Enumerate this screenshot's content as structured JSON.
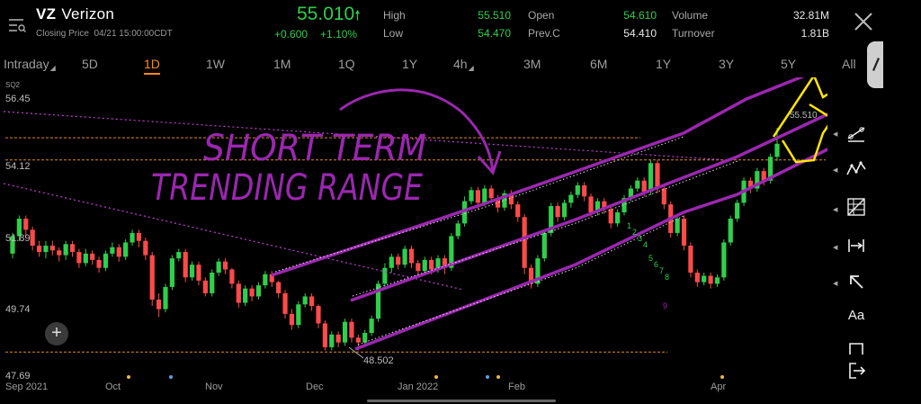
{
  "header": {
    "symbol": "VZ",
    "name": "Verizon",
    "closing_label": "Closing Price",
    "closing_time": "04/21 15:00:00CDT",
    "price": "55.010",
    "change": "+0.600",
    "change_pct": "+1.10%",
    "stats": [
      {
        "label": "High",
        "value": "55.510",
        "color": "green"
      },
      {
        "label": "Low",
        "value": "54.470",
        "color": "green"
      },
      {
        "label": "Open",
        "value": "54.610",
        "color": "green"
      },
      {
        "label": "Prev.C",
        "value": "54.410",
        "color": "white"
      },
      {
        "label": "Volume",
        "value": "32.81M",
        "color": "white"
      },
      {
        "label": "Turnover",
        "value": "1.81B",
        "color": "white"
      }
    ]
  },
  "tabs": [
    {
      "label": "Intraday",
      "dropdown": true
    },
    {
      "label": "5D"
    },
    {
      "label": "1D",
      "active": true
    },
    {
      "label": "1W"
    },
    {
      "label": "1M"
    },
    {
      "label": "1Q"
    },
    {
      "label": "1Y"
    },
    {
      "label": "4h",
      "dropdown": true
    },
    {
      "label": "3M"
    },
    {
      "label": "6M"
    },
    {
      "label": "1Y"
    },
    {
      "label": "3Y"
    },
    {
      "label": "5Y"
    },
    {
      "label": "All"
    }
  ],
  "chart_data": {
    "type": "candlestick",
    "y_ticks": [
      "56.45",
      "54.12",
      "51.89",
      "49.74",
      "47.69"
    ],
    "y_range": [
      47.69,
      56.45
    ],
    "x_ticks": [
      "Sep 2021",
      "Oct",
      "Nov",
      "Dec",
      "Jan 2022",
      "Feb",
      "Apr"
    ],
    "orange_levels": [
      55.2,
      54.5,
      48.45
    ],
    "annotations": {
      "low_marker": "48.502",
      "high_marker": "55.510",
      "td_counts_green": [
        "1",
        "2",
        "3",
        "4",
        "5",
        "6",
        "7",
        "8"
      ],
      "td_count_red": "9",
      "handwritten": [
        "SHORT TERM",
        "TRENDING RANGE"
      ],
      "partial_top_label": "SQ2"
    },
    "colors": {
      "up": "#2fcf4a",
      "down": "#ff4a4a",
      "pen": "#9b27b0",
      "forecast": "#ffe600",
      "level": "#e08a1e",
      "dotted": "#c33fd6"
    },
    "candles": [
      [
        51.55,
        52.1,
        51.4,
        52.2
      ],
      [
        52.1,
        52.65,
        51.95,
        52.75
      ],
      [
        52.65,
        52.3,
        52.1,
        52.75
      ],
      [
        52.3,
        51.8,
        51.65,
        52.4
      ],
      [
        51.8,
        51.6,
        51.45,
        51.95
      ],
      [
        51.6,
        51.8,
        51.4,
        51.95
      ],
      [
        51.8,
        51.65,
        51.5,
        51.95
      ],
      [
        51.65,
        51.5,
        51.3,
        51.75
      ],
      [
        51.5,
        51.85,
        51.35,
        51.95
      ],
      [
        51.85,
        51.6,
        51.45,
        51.95
      ],
      [
        51.6,
        51.25,
        51.1,
        51.7
      ],
      [
        51.25,
        51.55,
        51.15,
        51.7
      ],
      [
        51.55,
        51.35,
        51.2,
        51.65
      ],
      [
        51.35,
        51.1,
        50.95,
        51.45
      ],
      [
        51.1,
        51.55,
        51.0,
        51.65
      ],
      [
        51.55,
        51.75,
        51.45,
        51.9
      ],
      [
        51.75,
        51.45,
        51.3,
        51.85
      ],
      [
        51.45,
        51.9,
        51.35,
        52.0
      ],
      [
        51.9,
        52.2,
        51.8,
        52.3
      ],
      [
        52.2,
        51.95,
        51.75,
        52.3
      ],
      [
        51.95,
        51.5,
        51.35,
        52.05
      ],
      [
        51.5,
        50.1,
        49.9,
        51.6
      ],
      [
        50.1,
        49.8,
        49.55,
        50.3
      ],
      [
        49.8,
        50.5,
        49.7,
        50.6
      ],
      [
        50.5,
        51.4,
        50.4,
        51.5
      ],
      [
        51.4,
        51.6,
        51.3,
        51.7
      ],
      [
        51.6,
        50.8,
        50.65,
        51.7
      ],
      [
        50.8,
        51.2,
        50.7,
        51.3
      ],
      [
        51.2,
        50.7,
        50.55,
        51.3
      ],
      [
        50.7,
        50.3,
        50.2,
        50.8
      ],
      [
        50.3,
        50.95,
        50.2,
        51.05
      ],
      [
        50.95,
        51.3,
        50.85,
        51.4
      ],
      [
        51.3,
        51.05,
        50.9,
        51.4
      ],
      [
        51.05,
        50.6,
        50.45,
        51.1
      ],
      [
        50.6,
        50.0,
        49.85,
        50.7
      ],
      [
        50.0,
        50.45,
        49.9,
        50.55
      ],
      [
        50.45,
        50.2,
        50.05,
        50.55
      ],
      [
        50.2,
        50.55,
        50.1,
        50.65
      ],
      [
        50.55,
        50.9,
        50.45,
        51.0
      ],
      [
        50.9,
        50.65,
        50.5,
        51.0
      ],
      [
        50.65,
        50.3,
        50.15,
        50.7
      ],
      [
        50.3,
        49.65,
        49.5,
        50.4
      ],
      [
        49.65,
        49.3,
        49.15,
        49.8
      ],
      [
        49.3,
        49.95,
        49.2,
        50.05
      ],
      [
        49.95,
        50.2,
        49.85,
        50.3
      ],
      [
        50.2,
        49.9,
        49.75,
        50.3
      ],
      [
        49.9,
        49.35,
        49.2,
        49.95
      ],
      [
        49.35,
        48.6,
        48.5,
        49.45
      ],
      [
        48.6,
        49.0,
        48.5,
        49.1
      ],
      [
        49.0,
        48.75,
        48.6,
        49.1
      ],
      [
        48.75,
        49.4,
        48.65,
        49.5
      ],
      [
        49.4,
        48.9,
        48.75,
        49.5
      ],
      [
        48.9,
        48.75,
        48.5,
        49.0
      ],
      [
        48.75,
        49.05,
        48.65,
        49.15
      ],
      [
        49.05,
        49.5,
        48.95,
        49.6
      ],
      [
        49.5,
        50.6,
        49.4,
        50.7
      ],
      [
        50.6,
        51.1,
        50.5,
        51.25
      ],
      [
        51.1,
        51.45,
        50.95,
        51.55
      ],
      [
        51.45,
        51.2,
        51.05,
        51.55
      ],
      [
        51.2,
        51.7,
        51.1,
        51.8
      ],
      [
        51.7,
        51.25,
        51.1,
        51.8
      ],
      [
        51.25,
        51.0,
        50.85,
        51.35
      ],
      [
        51.0,
        51.35,
        50.9,
        51.45
      ],
      [
        51.35,
        51.05,
        50.9,
        51.45
      ],
      [
        51.05,
        51.4,
        50.95,
        51.5
      ],
      [
        51.4,
        51.1,
        50.9,
        51.5
      ],
      [
        51.1,
        52.1,
        51.0,
        52.2
      ],
      [
        52.1,
        52.5,
        52.0,
        52.6
      ],
      [
        52.5,
        53.2,
        52.4,
        53.35
      ],
      [
        53.2,
        53.55,
        53.1,
        53.65
      ],
      [
        53.55,
        53.15,
        52.95,
        53.65
      ],
      [
        53.15,
        53.6,
        53.05,
        53.7
      ],
      [
        53.6,
        53.3,
        53.15,
        53.7
      ],
      [
        53.3,
        53.0,
        52.85,
        53.4
      ],
      [
        53.0,
        53.45,
        52.9,
        53.55
      ],
      [
        53.45,
        53.1,
        52.95,
        53.55
      ],
      [
        53.1,
        52.7,
        52.55,
        53.2
      ],
      [
        52.7,
        51.1,
        50.9,
        52.8
      ],
      [
        51.1,
        50.6,
        50.45,
        51.2
      ],
      [
        50.6,
        51.4,
        50.5,
        51.5
      ],
      [
        51.4,
        52.2,
        51.3,
        52.3
      ],
      [
        52.2,
        53.05,
        52.1,
        53.15
      ],
      [
        53.05,
        52.7,
        52.55,
        53.15
      ],
      [
        52.7,
        53.15,
        52.6,
        53.25
      ],
      [
        53.15,
        53.4,
        53.0,
        53.5
      ],
      [
        53.4,
        53.7,
        53.3,
        53.8
      ],
      [
        53.7,
        53.35,
        53.2,
        53.8
      ],
      [
        53.35,
        52.85,
        52.7,
        53.45
      ],
      [
        52.85,
        53.2,
        52.75,
        53.3
      ],
      [
        53.2,
        52.95,
        52.8,
        53.3
      ],
      [
        52.95,
        52.5,
        52.35,
        53.05
      ],
      [
        52.5,
        52.85,
        52.4,
        52.95
      ],
      [
        52.85,
        53.3,
        52.75,
        53.4
      ],
      [
        53.3,
        53.6,
        53.2,
        53.7
      ],
      [
        53.6,
        53.85,
        53.5,
        53.95
      ],
      [
        53.85,
        53.5,
        53.35,
        53.95
      ],
      [
        53.5,
        54.4,
        53.4,
        54.5
      ],
      [
        54.4,
        53.6,
        53.45,
        54.5
      ],
      [
        53.6,
        53.1,
        52.95,
        53.7
      ],
      [
        53.1,
        52.2,
        52.05,
        53.2
      ],
      [
        52.2,
        52.65,
        52.1,
        52.75
      ],
      [
        52.65,
        51.8,
        51.65,
        52.75
      ],
      [
        51.8,
        50.95,
        50.8,
        51.9
      ],
      [
        50.95,
        50.65,
        50.5,
        51.05
      ],
      [
        50.65,
        50.85,
        50.55,
        50.95
      ],
      [
        50.85,
        50.6,
        50.45,
        50.95
      ],
      [
        50.6,
        50.8,
        50.5,
        50.9
      ],
      [
        50.8,
        51.9,
        50.7,
        52.0
      ],
      [
        51.9,
        52.65,
        51.8,
        52.75
      ],
      [
        52.65,
        53.15,
        52.55,
        53.25
      ],
      [
        53.15,
        53.85,
        53.05,
        53.95
      ],
      [
        53.85,
        53.6,
        53.45,
        53.95
      ],
      [
        53.6,
        54.15,
        53.5,
        54.25
      ],
      [
        54.15,
        53.85,
        53.7,
        54.25
      ],
      [
        53.85,
        54.6,
        53.75,
        54.7
      ],
      [
        54.6,
        55.01,
        54.47,
        55.51
      ]
    ]
  },
  "tools": [
    "pencil-icon",
    "trendline-icon",
    "wave-icon",
    "fib-grid-icon",
    "measure-icon",
    "arrow-icon",
    "text-tool",
    "rect-icon",
    "exit-icon"
  ],
  "tool_text": "Aa"
}
